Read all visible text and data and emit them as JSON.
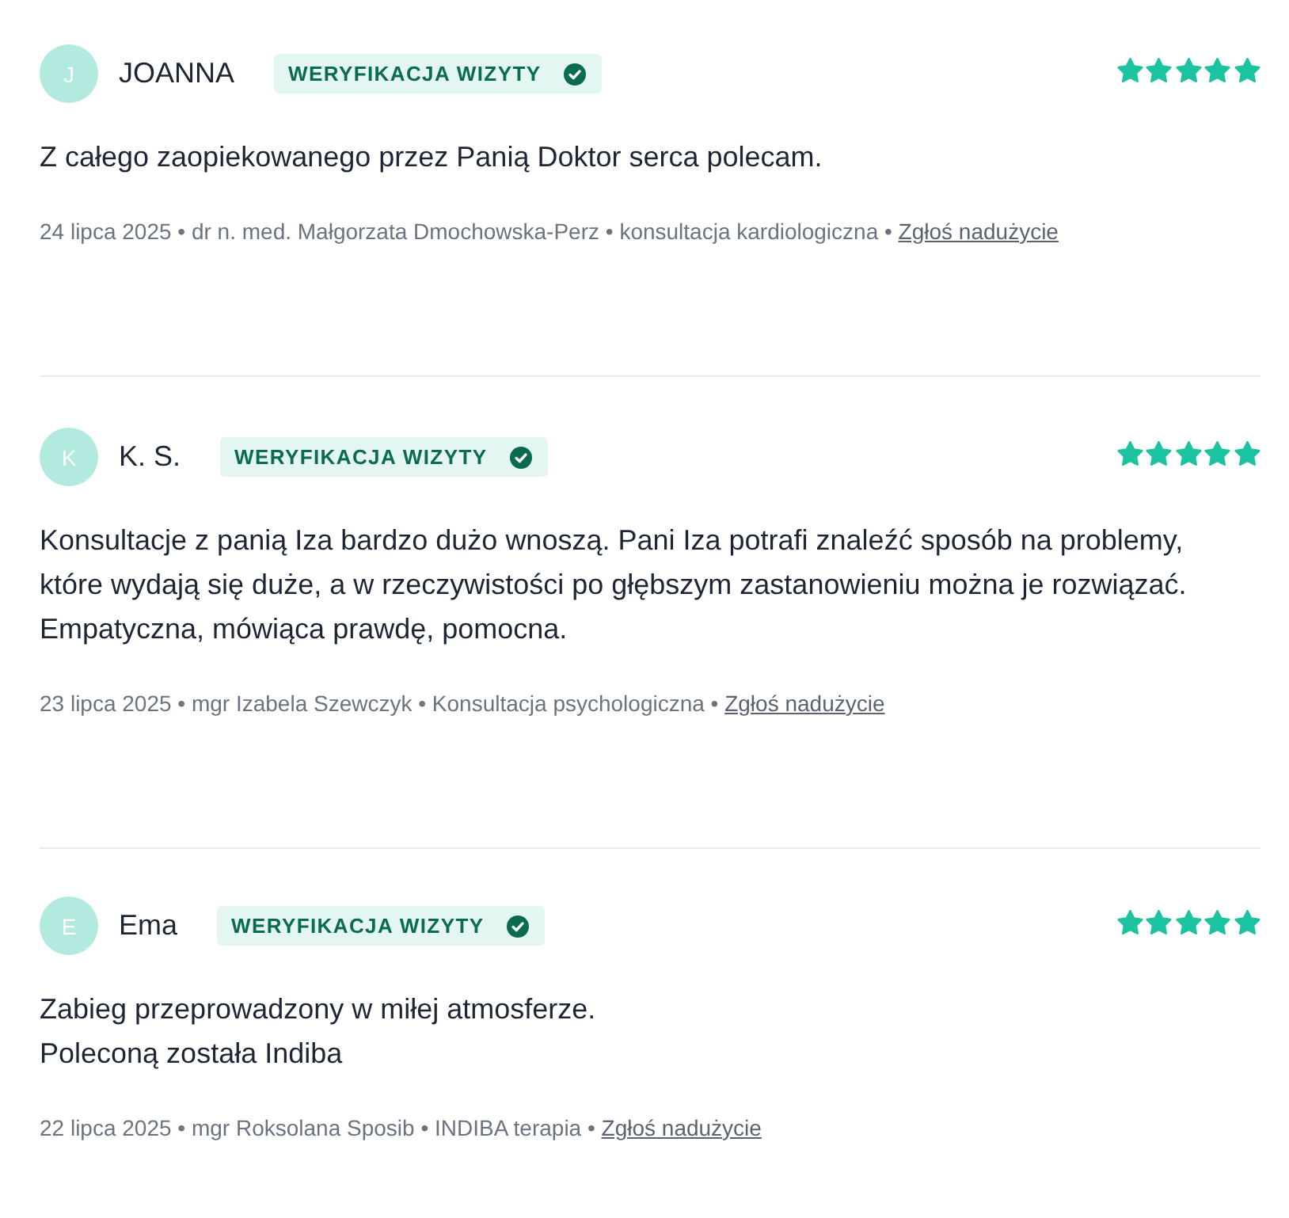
{
  "reviews": [
    {
      "initial": "J",
      "name": "JOANNA",
      "badge": "WERYFIKACJA WIZYTY",
      "stars": 5,
      "text": "Z całego zaopiekowanego przez Panią Doktor serca polecam.",
      "meta": "24 lipca 2025 • dr n. med. Małgorzata Dmochowska-Perz • konsultacja kardiologiczna •",
      "report_link": "Zgłoś nadużycie"
    },
    {
      "initial": "K",
      "name": "K. S.",
      "badge": "WERYFIKACJA WIZYTY",
      "stars": 5,
      "text": "Konsultacje z panią Iza bardzo dużo wnoszą. Pani Iza potrafi znaleźć sposób na problemy, które wydają się duże, a w rzeczywistości po głębszym zastanowieniu można je rozwiązać. Empatyczna, mówiąca prawdę, pomocna.",
      "meta": "23 lipca 2025 • mgr Izabela Szewczyk • Konsultacja psychologiczna •",
      "report_link": "Zgłoś nadużycie"
    },
    {
      "initial": "E",
      "name": "Ema",
      "badge": "WERYFIKACJA WIZYTY",
      "stars": 5,
      "text": "Zabieg przeprowadzony w miłej atmosferze.\nPoleconą została Indiba",
      "meta": "22 lipca 2025 • mgr Roksolana Sposib • INDIBA terapia •",
      "report_link": "Zgłoś nadużycie"
    }
  ]
}
